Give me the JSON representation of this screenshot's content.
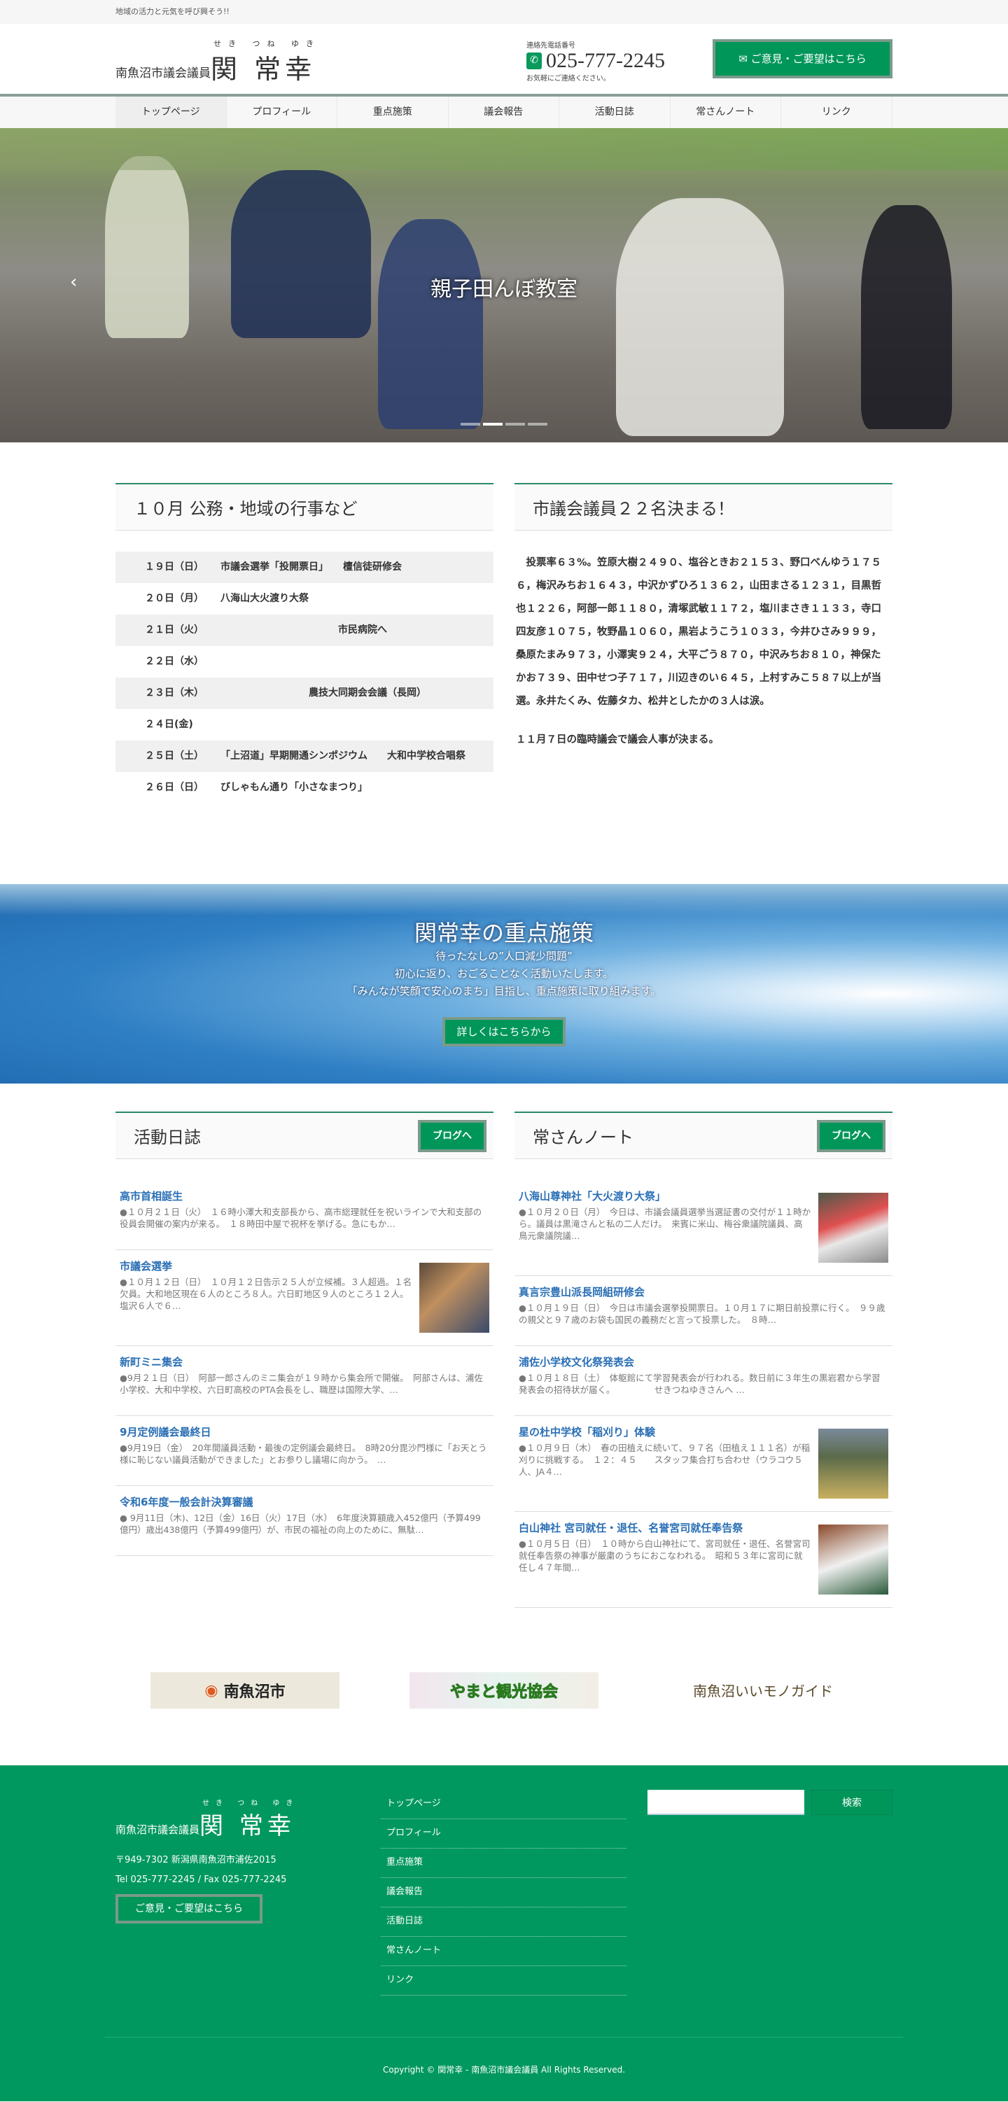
{
  "topbar": {
    "tagline": "地域の活力と元気を呼び興そう!!"
  },
  "header": {
    "pre": "南魚沼市議会議員",
    "name": "関 常幸",
    "ruby": "せき つね ゆき",
    "phone_label": "連絡先電話番号",
    "phone": "025-777-2245",
    "phone_sub": "お気軽にご連絡ください。",
    "contact_label": "✉ ご意見・ご要望はこちら"
  },
  "nav": [
    "トップページ",
    "プロフィール",
    "重点施策",
    "議会報告",
    "活動日誌",
    "常さんノート",
    "リンク"
  ],
  "hero": {
    "caption": "親子田んぼ教室",
    "slides": 4,
    "active_slide": 2
  },
  "events": {
    "title": "１０月 公務・地域の行事など",
    "rows": [
      {
        "d": "１９日（日）",
        "t": "市議会選挙「投開票日」　　檀信徒研修会"
      },
      {
        "d": "２０日（月）",
        "t": "八海山大火渡り大祭"
      },
      {
        "d": "２１日（火）",
        "t": "　　　　　　　　　　　　市民病院へ"
      },
      {
        "d": "２２日（水）",
        "t": ""
      },
      {
        "d": "２３日（木）",
        "t": "　　　　　　　　　農技大同期会会議（長岡）"
      },
      {
        "d": "２４日(金)",
        "t": ""
      },
      {
        "d": "２５日（土）",
        "t": "「上沼道」早期開通シンポジウム　　大和中学校合唱祭"
      },
      {
        "d": "２６日（日）",
        "t": "びしゃもん通り「小さなまつり」"
      }
    ]
  },
  "news": {
    "title": "市議会議員２２名決まる！",
    "p1": "　投票率６３%。笠原大樹２４９０、塩谷ときお２１５３、野口べんゆう１７５６，梅沢みちお１６４３，中沢かずひろ１３６２，山田まさる１２３１，目黒哲也１２２６，阿部一郎１１８０，清塚武敏１１７２，塩川まさき１１３３，寺口四友彦１０７５，牧野晶１０６０，黒岩ようこう１０３３，今井ひさみ９９９，桑原たまみ９７３，小澤実９２４，大平ごう８７０，中沢みちお８１０，神保たかお７３９、田中せつ子７１７，川辺きのい６４５，上村すみこ５８７以上が当選。永井たくみ、佐藤タカ、松井としたかの３人は涙。",
    "p2": "１１月７日の臨時議会で議会人事が決まる。"
  },
  "banner": {
    "title": "関常幸の重点施策",
    "lines": [
      "待ったなしの”人口減少問題”",
      "初心に返り、おごることなく活動いたします。",
      "「みんなが笑顔で安心のまち」目指し、重点施策に取り組みます。"
    ],
    "button": "詳しくはこちらから"
  },
  "diary": {
    "title": "活動日誌",
    "button": "ブログへ",
    "posts": [
      {
        "title": "高市首相誕生",
        "body": "●１０月２１日（火）　１６時小澤大和支部長から、高市総理就任を祝いラインで大和支部の役員会開催の案内が来る。　１８時田中屋で祝杯を挙げる。急にもか…",
        "thumb": false
      },
      {
        "title": "市議会選挙",
        "body": "●１０月１２日（日）　１０月１２日告示２５人が立候補。３人超過。１名欠員。大和地区現在６人のところ８人。六日町地区９人のところ１２人。塩沢６人で６…",
        "thumb": true
      },
      {
        "title": "新町ミニ集会",
        "body": "●9月２１日（日）　阿部一郎さんのミニ集会が１９時から集会所で開催。　阿部さんは、浦佐小学校、大和中学校、六日町高校のPTA会長をし、職歴は国際大学、…",
        "thumb": false
      },
      {
        "title": "9月定例議会最終日",
        "body": "●9月19日（金）　20年間議員活動・最後の定例議会最終日。　8時20分毘沙門様に「お天とう様に恥じない議員活動ができました」とお参りし議場に向かう。　…",
        "thumb": false
      },
      {
        "title": "令和6年度一般会計決算審議",
        "body": "● 9月11日（木)、12日（金）16日（火）17日（水）　6年度決算額歳入452億円（予算499億円）歳出438億円（予算499億円）が、市民の福祉の向上のために、無駄…",
        "thumb": false
      }
    ]
  },
  "note": {
    "title": "常さんノート",
    "button": "ブログへ",
    "posts": [
      {
        "title": "八海山尊神社「大火渡り大祭」",
        "body": "●１０月２０日（月）　今日は、市議会議員選挙当選証書の交付が１１時から。議員は黒滝さんと私の二人だけ。　来賓に米山、梅谷衆議院議員、高鳥元衆議院議…",
        "thumb": true
      },
      {
        "title": "真言宗豊山派長岡組研修会",
        "body": "●１０月１９日（日）　今日は市議会選挙投開票日。１０月１７に期日前投票に行く。　９９歳の親父と９７歳のお袋も国民の義務だと言って投票した。　８時…",
        "thumb": false
      },
      {
        "title": "浦佐小学校文化祭発表会",
        "body": "●１０月１８日（土）　体躯館にて学習発表会が行われる。数日前に３年生の黒岩君から学習発表会の招待状が届く。　　　　　せきつねゆきさんへ …",
        "thumb": false
      },
      {
        "title": "星の杜中学校「稲刈り」体験",
        "body": "●１０月９日（木）　春の田植えに続いて、９７名（田植え１１１名）が稲刈りに挑戦する。　１２：４５　　スタッフ集合打ち合わせ（ウラコウ５人、JA４…",
        "thumb": true
      },
      {
        "title": "白山神社 宮司就任・退任、名誉宮司就任奉告祭",
        "body": "●１０月５日（日）　１０時から白山神社にて、宮司就任・退任、名誉宮司就任奉告祭の神事が厳粛のうちにおこなわれる。　昭和５３年に宮司に就任し４７年間…",
        "thumb": true
      }
    ]
  },
  "links": [
    "南魚沼市",
    "やまと観光協会",
    "南魚沼いいモノガイド"
  ],
  "footer": {
    "pre": "南魚沼市議会議員",
    "name": "関 常幸",
    "ruby": "せき つね ゆき",
    "address": "〒949-7302 新潟県南魚沼市浦佐2015",
    "tel": "Tel 025-777-2245 / Fax 025-777-2245",
    "contact": "ご意見・ご要望はこちら",
    "nav": [
      "トップページ",
      "プロフィール",
      "重点施策",
      "議会報告",
      "活動日誌",
      "常さんノート",
      "リンク"
    ],
    "search_button": "検索",
    "copyright": "Copyright © 関常幸 - 南魚沼市議会議員 All Rights Reserved."
  },
  "colors": {
    "brand_green": "#00985f",
    "link_blue": "#2a6fb5"
  }
}
